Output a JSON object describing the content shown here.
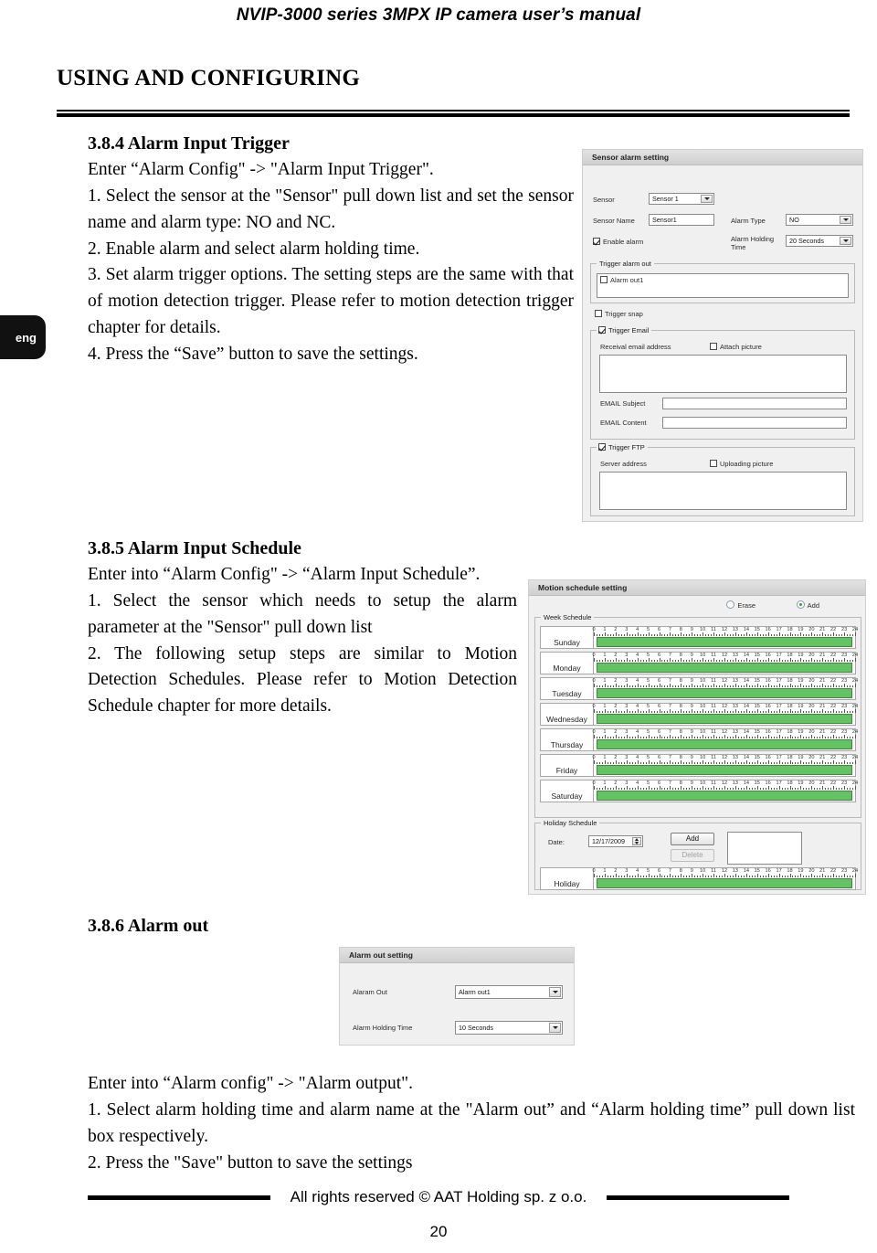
{
  "header": {
    "running_head": "NVIP-3000 series 3MPX IP camera user’s manual"
  },
  "lang_tab": {
    "label": "eng"
  },
  "chapter": {
    "title": "USING AND CONFIGURING"
  },
  "sections": {
    "s384": {
      "heading": "3.8.4 Alarm Input Trigger",
      "intro": "Enter “Alarm Config\" -> \"Alarm Input Trigger\".",
      "steps": [
        "1. Select the sensor at the \"Sensor\" pull down list and set the sensor name and alarm type: NO and NC.",
        "2. Enable alarm and select alarm holding time.",
        "3. Set alarm trigger options. The setting steps are the same with that of motion detection trigger. Please refer to motion detection trigger chapter for details.",
        "4. Press the “Save” button to save the settings."
      ]
    },
    "s385": {
      "heading": "3.8.5 Alarm Input Schedule",
      "intro": "Enter into “Alarm Config\" -> “Alarm Input Schedule”.",
      "steps": [
        "1. Select the sensor which needs to setup the alarm parameter at the \"Sensor\" pull down list",
        "2. The following setup steps are similar to Motion Detection Schedules. Please refer to Motion Detection Schedule chapter for more details."
      ]
    },
    "s386": {
      "heading": "3.8.6 Alarm out",
      "intro": "Enter into “Alarm config\" -> \"Alarm output\".",
      "steps": [
        "1. Select alarm holding time and alarm name at the \"Alarm out” and “Alarm holding time” pull down list box respectively.",
        "2. Press the \"Save\" button to save the settings"
      ]
    }
  },
  "sensor_alarm_setting": {
    "title": "Sensor alarm setting",
    "sensor_label": "Sensor",
    "sensor_value": "Sensor 1",
    "sensor_name_label": "Sensor Name",
    "sensor_name_value": "Sensor1",
    "alarm_type_label": "Alarm Type",
    "alarm_type_value": "NO",
    "enable_alarm_label": "Enable alarm",
    "enable_alarm_checked": true,
    "alarm_holding_label": "Alarm Holding Time",
    "alarm_holding_value": "20 Seconds",
    "trigger_alarm_out_caption": "Trigger alarm out",
    "alarm_out1_label": "Alarm out1",
    "alarm_out1_checked": false,
    "trigger_snap_label": "Trigger snap",
    "trigger_snap_checked": false,
    "trigger_email_label": "Trigger Email",
    "trigger_email_checked": true,
    "receival_email_label": "Receival email address",
    "attach_picture_label": "Attach picture",
    "attach_picture_checked": false,
    "email_subject_label": "EMAIL Subject",
    "email_subject_value": "",
    "email_content_label": "EMAIL Content",
    "email_content_value": "",
    "trigger_ftp_label": "Trigger FTP",
    "trigger_ftp_checked": true,
    "server_address_label": "Server address",
    "uploading_picture_label": "Uploading picture",
    "uploading_picture_checked": false
  },
  "motion_schedule_setting": {
    "title": "Motion schedule setting",
    "erase_label": "Erase",
    "add_radio_label": "Add",
    "mode_selected": "Add",
    "week_schedule_caption": "Week Schedule",
    "hour_ticks": [
      "0",
      "1",
      "2",
      "3",
      "4",
      "5",
      "6",
      "7",
      "8",
      "9",
      "10",
      "11",
      "12",
      "13",
      "14",
      "15",
      "16",
      "17",
      "18",
      "19",
      "20",
      "21",
      "22",
      "23",
      "24"
    ],
    "days": [
      {
        "name": "Sunday",
        "start": 0,
        "end": 24
      },
      {
        "name": "Monday",
        "start": 0,
        "end": 24
      },
      {
        "name": "Tuesday",
        "start": 0,
        "end": 24
      },
      {
        "name": "Wednesday",
        "start": 0,
        "end": 24
      },
      {
        "name": "Thursday",
        "start": 0,
        "end": 24
      },
      {
        "name": "Friday",
        "start": 0,
        "end": 24
      },
      {
        "name": "Saturday",
        "start": 0,
        "end": 24
      }
    ],
    "holiday_schedule_caption": "Holiday Schedule",
    "date_label": "Date:",
    "date_value": "12/17/2009",
    "add_button": "Add",
    "delete_button": "Delete",
    "delete_disabled": true,
    "holiday_list_value": "",
    "holiday_row": {
      "name": "Holiday",
      "start": 0,
      "end": 24
    }
  },
  "alarm_out_setting": {
    "title": "Alarm out setting",
    "alarm_out_label": "Alaram Out",
    "alarm_out_value": "Alarm out1",
    "holding_time_label": "Alarm Holding Time",
    "holding_time_value": "10 Seconds"
  },
  "footer": {
    "copyright": "All rights reserved © AAT Holding sp. z o.o.",
    "page_number": "20"
  }
}
